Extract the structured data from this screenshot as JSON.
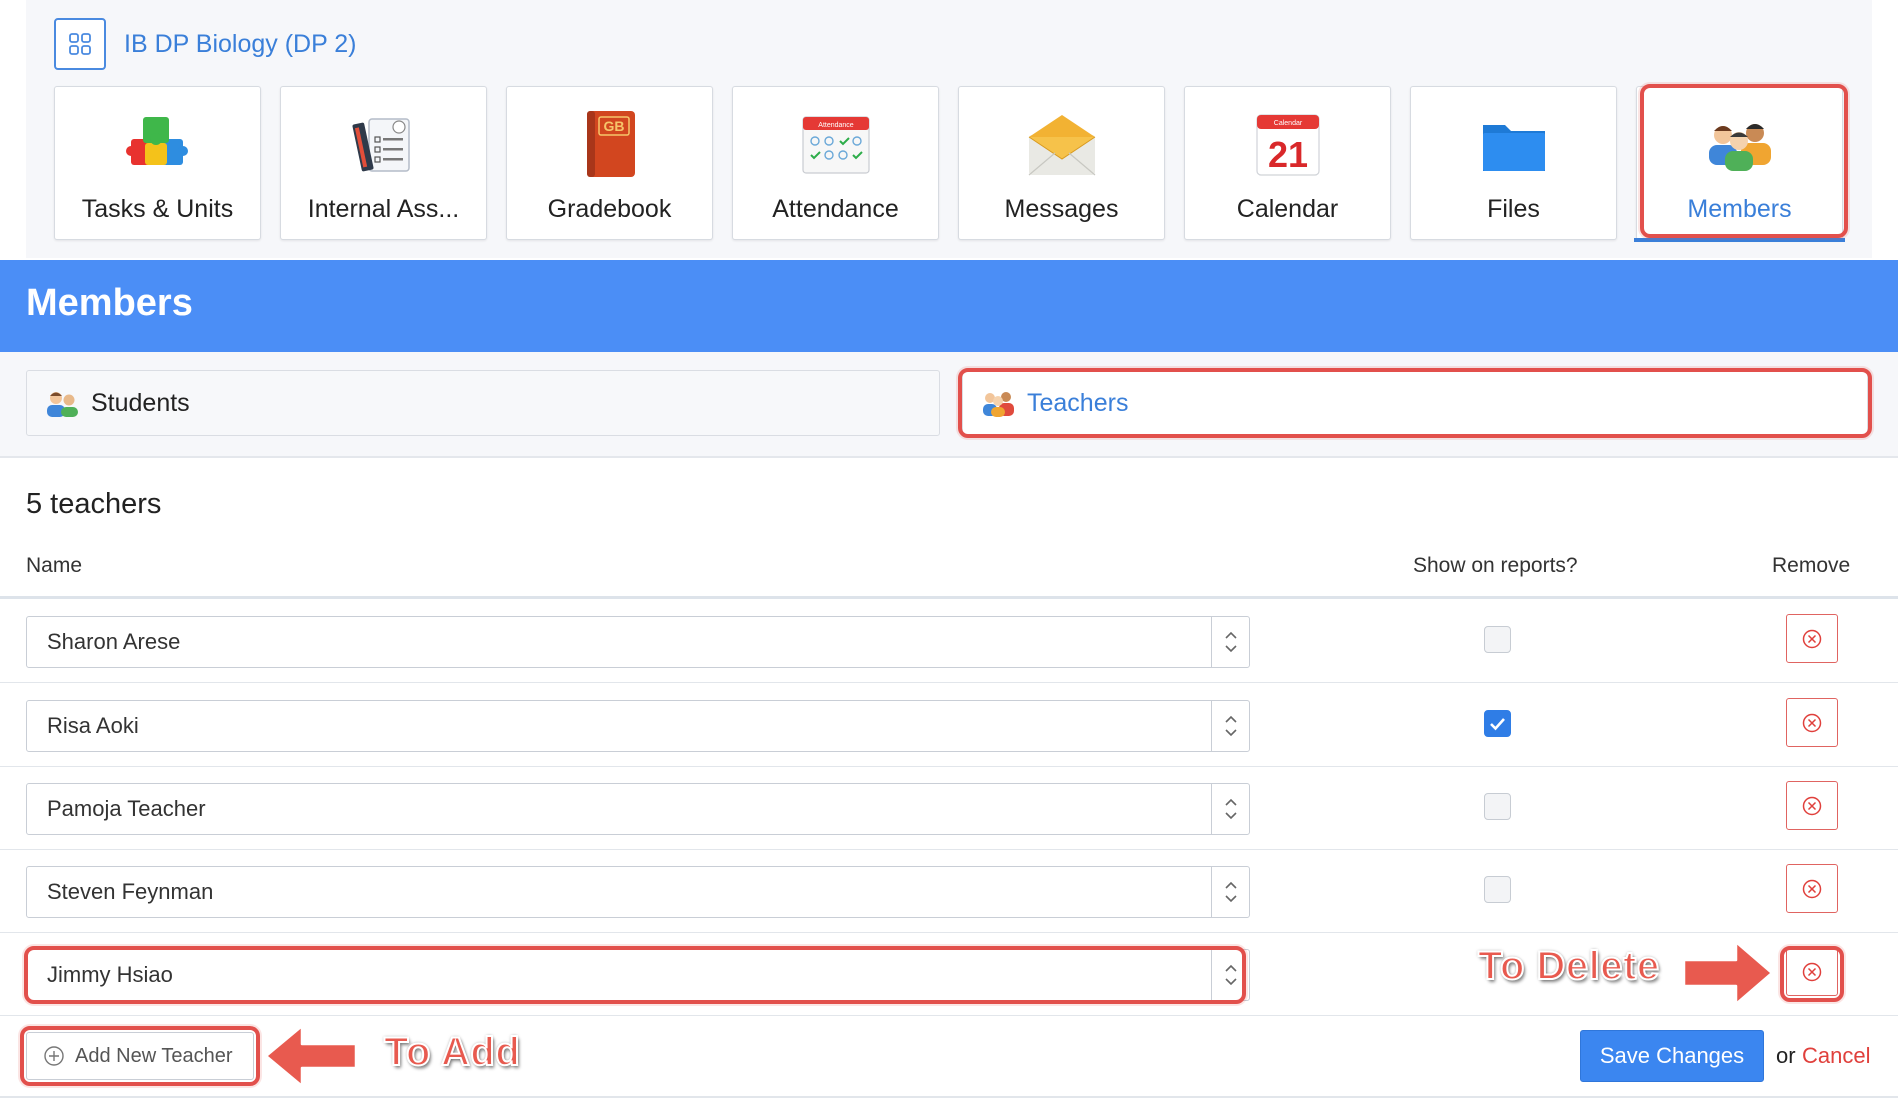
{
  "course": {
    "title": "IB DP Biology (DP 2)"
  },
  "tiles": [
    {
      "label": "Tasks & Units",
      "icon": "puzzle-icon"
    },
    {
      "label": "Internal Ass...",
      "icon": "checklist-icon"
    },
    {
      "label": "Gradebook",
      "icon": "gradebook-icon",
      "badge": "GB"
    },
    {
      "label": "Attendance",
      "icon": "attendance-icon",
      "badge": "Attendance"
    },
    {
      "label": "Messages",
      "icon": "envelope-icon"
    },
    {
      "label": "Calendar",
      "icon": "calendar-icon",
      "badge": "Calendar",
      "day": "21"
    },
    {
      "label": "Files",
      "icon": "folder-icon"
    },
    {
      "label": "Members",
      "icon": "members-icon",
      "active": true
    }
  ],
  "banner": {
    "title": "Members"
  },
  "subtabs": {
    "students": "Students",
    "teachers": "Teachers"
  },
  "teachers": {
    "count_label": "5 teachers",
    "columns": {
      "name": "Name",
      "show": "Show on reports?",
      "remove": "Remove"
    },
    "rows": [
      {
        "name": "Sharon Arese",
        "show_on_reports": false
      },
      {
        "name": "Risa Aoki",
        "show_on_reports": true
      },
      {
        "name": "Pamoja Teacher",
        "show_on_reports": false
      },
      {
        "name": "Steven Feynman",
        "show_on_reports": false
      },
      {
        "name": "Jimmy Hsiao",
        "show_on_reports": false
      }
    ]
  },
  "footer": {
    "add_label": "Add New Teacher",
    "save_label": "Save Changes",
    "or_label": "or",
    "cancel_label": "Cancel"
  },
  "annotations": {
    "to_add": "To Add",
    "to_delete": "To Delete"
  },
  "colors": {
    "accent": "#4b8ef6",
    "link": "#3a7fd9",
    "highlight": "#e2504c",
    "cancel": "#e0403c"
  }
}
